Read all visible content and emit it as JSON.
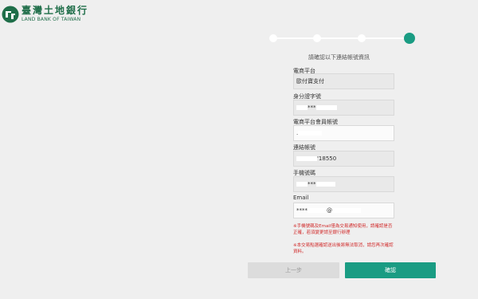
{
  "brand": {
    "name": "臺灣土地銀行",
    "name_en": "LAND BANK OF TAIWAN",
    "color": "#1f6e49"
  },
  "stepper": {
    "total": 4,
    "current": 4,
    "accent": "#1a9c83"
  },
  "form": {
    "heading": "請確認以下連結帳號資訊",
    "fields": [
      {
        "label": "電商平台",
        "value": "歐付寶支付"
      },
      {
        "label": "身分證字號",
        "value": "***"
      },
      {
        "label": "電商平台會員帳號",
        "value": "."
      },
      {
        "label": "連結帳號",
        "value": "'18550"
      },
      {
        "label": "手機號碼",
        "value": "***"
      },
      {
        "label": "Email",
        "value_prefix": "****",
        "value_mid": "@"
      }
    ],
    "notice1": "※手機號碼及Email僅為交易通知使用，請確認是否正確，若須變更請至銀行辦理",
    "notice2": "※本交易點選確認送出後將無法取消，請您再次確認資料。"
  },
  "buttons": {
    "prev": "上一步",
    "confirm": "確認"
  }
}
